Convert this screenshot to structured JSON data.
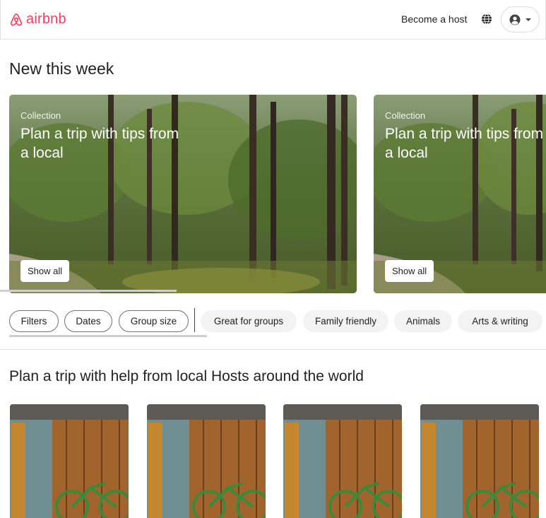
{
  "header": {
    "logo_text": "airbnb",
    "become_host": "Become a host",
    "brand_color": "#ff385c"
  },
  "new_this_week": {
    "title": "New this week",
    "cards": [
      {
        "kicker": "Collection",
        "title": "Plan a trip with tips from a local",
        "button": "Show all"
      },
      {
        "kicker": "Collection",
        "title": "Plan a trip with tips from a local",
        "button": "Show all"
      }
    ]
  },
  "filters": {
    "buttons": [
      "Filters",
      "Dates",
      "Group size"
    ],
    "categories": [
      "Great for groups",
      "Family friendly",
      "Animals",
      "Arts & writing"
    ]
  },
  "hosts_section": {
    "title": "Plan a trip with help from local Hosts around the world"
  },
  "icons": [
    "airbnb-logo-icon",
    "globe-icon",
    "user-icon",
    "caret-down-icon"
  ]
}
